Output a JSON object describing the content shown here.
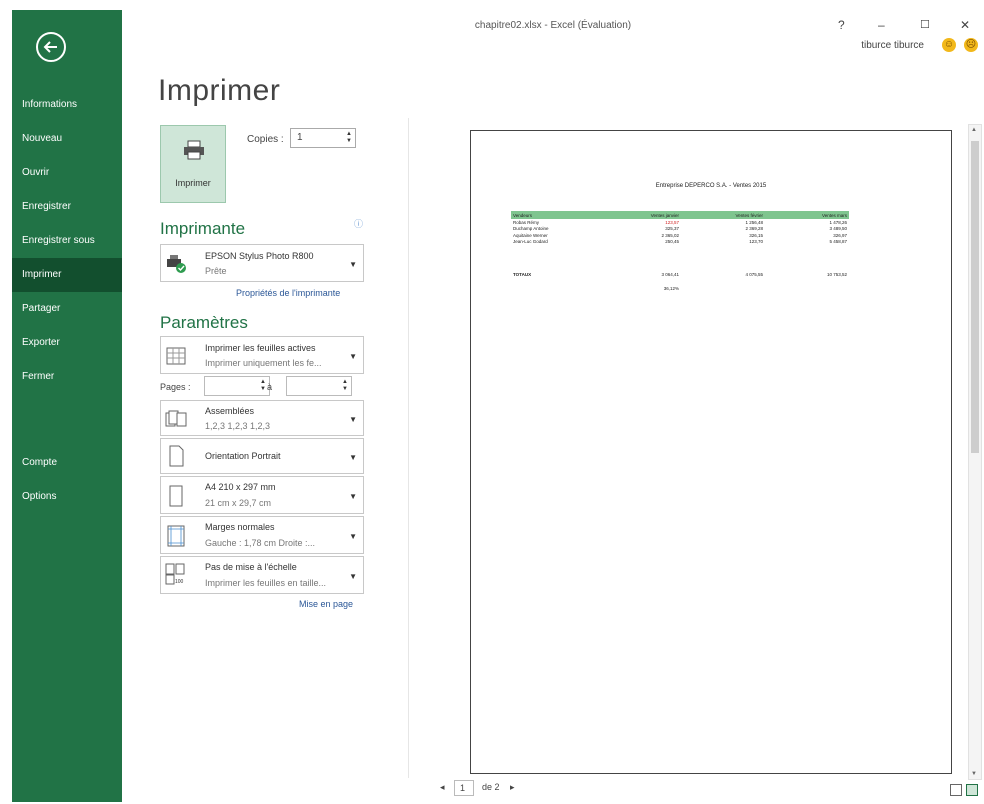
{
  "window": {
    "title": "chapitre02.xlsx - Excel (Évaluation)",
    "help": "?",
    "minimize": "–",
    "maximize": "☐",
    "close": "✕",
    "user": "tiburce tiburce"
  },
  "sidebar": {
    "items": [
      {
        "label": "Informations"
      },
      {
        "label": "Nouveau"
      },
      {
        "label": "Ouvrir"
      },
      {
        "label": "Enregistrer"
      },
      {
        "label": "Enregistrer sous"
      },
      {
        "label": "Imprimer"
      },
      {
        "label": "Partager"
      },
      {
        "label": "Exporter"
      },
      {
        "label": "Fermer"
      },
      {
        "label": "Compte"
      },
      {
        "label": "Options"
      }
    ],
    "active": "Imprimer"
  },
  "print": {
    "title": "Imprimer",
    "button_label": "Imprimer",
    "copies_label": "Copies :",
    "copies_value": "1"
  },
  "printer": {
    "section_title": "Imprimante",
    "name": "EPSON Stylus Photo R800",
    "status": "Prête",
    "properties_link": "Propriétés de l'imprimante"
  },
  "settings": {
    "section_title": "Paramètres",
    "what": {
      "line1": "Imprimer les feuilles actives",
      "line2": "Imprimer uniquement les fe..."
    },
    "pages_label": "Pages :",
    "pages_to": "à",
    "collate": {
      "line1": "Assemblées",
      "line2": "1,2,3   1,2,3   1,2,3"
    },
    "orientation": {
      "line1": "Orientation Portrait"
    },
    "paper": {
      "line1": "A4 210 x 297 mm",
      "line2": "21 cm x 29,7 cm"
    },
    "margins": {
      "line1": "Marges normales",
      "line2": "Gauche : 1,78 cm   Droite :..."
    },
    "scaling": {
      "line1": "Pas de mise à l'échelle",
      "line2": "Imprimer les feuilles en taille..."
    },
    "page_setup_link": "Mise en page"
  },
  "preview": {
    "sheet_title": "Entreprise DEPERCO S.A. - Ventes 2015",
    "columns": [
      "Vendeurs",
      "Ventes janvier",
      "Ventes février",
      "Ventes mars"
    ],
    "rows": [
      [
        "Robas Rémy",
        "123,57",
        "1 256,48",
        "1 478,26"
      ],
      [
        "Duchamp Antoine",
        "325,37",
        "2 369,28",
        "3 489,50"
      ],
      [
        "Aquitaine Werner",
        "2 365,02",
        "326,15",
        "326,97"
      ],
      [
        "Jean-Luc Godard",
        "250,45",
        "123,70",
        "5 458,87"
      ]
    ],
    "total_row": [
      "TOTAUX",
      "3 064,41",
      "4 075,55",
      "10 753,52"
    ],
    "percent": "36,12%",
    "page_current": "1",
    "page_of": "de 2"
  }
}
